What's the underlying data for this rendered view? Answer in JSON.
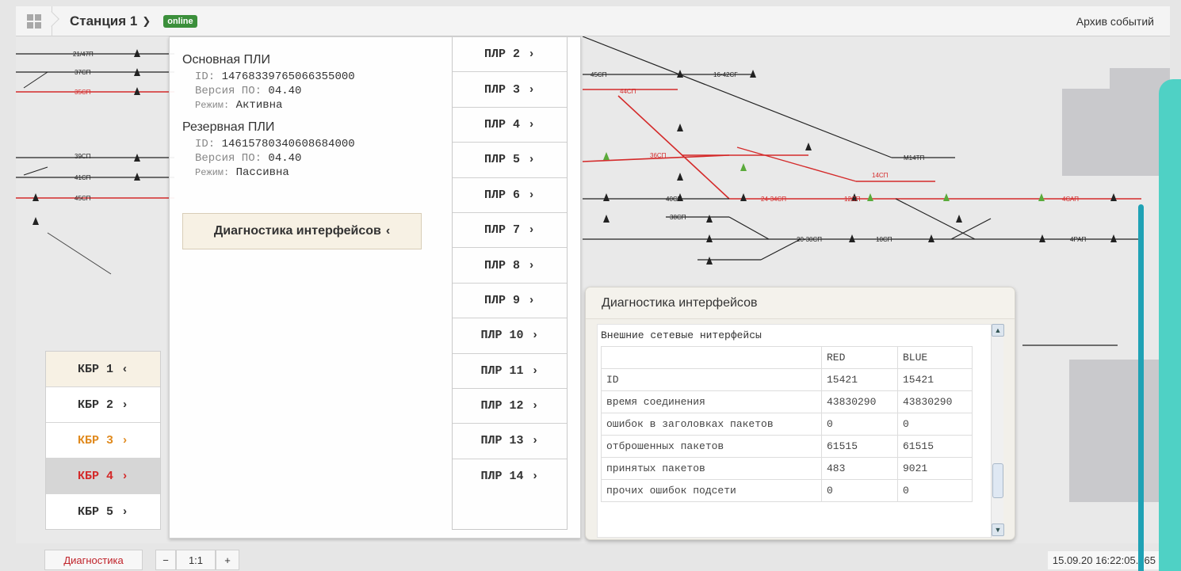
{
  "topbar": {
    "station_label": "Станция 1",
    "status_badge": "online",
    "archive_link": "Архив событий"
  },
  "primary_pli": {
    "title": "Основная ПЛИ",
    "id_label": "ID:",
    "id_value": "14768339765066355000",
    "version_label": "Версия ПО:",
    "version_value": "04.40",
    "mode_label": "Режим:",
    "mode_value": "Активна"
  },
  "reserve_pli": {
    "title": "Резервная ПЛИ",
    "id_label": "ID:",
    "id_value": "14615780340608684000",
    "version_label": "Версия ПО:",
    "version_value": "04.40",
    "mode_label": "Режим:",
    "mode_value": "Пассивна"
  },
  "diag_button": {
    "label": "Диагностика интерфейсов",
    "chevron": "‹"
  },
  "plr_items": [
    {
      "label": "ПЛР 2",
      "chevron": "›"
    },
    {
      "label": "ПЛР 3",
      "chevron": "›"
    },
    {
      "label": "ПЛР 4",
      "chevron": "›"
    },
    {
      "label": "ПЛР 5",
      "chevron": "›"
    },
    {
      "label": "ПЛР 6",
      "chevron": "›"
    },
    {
      "label": "ПЛР 7",
      "chevron": "›"
    },
    {
      "label": "ПЛР 8",
      "chevron": "›"
    },
    {
      "label": "ПЛР 9",
      "chevron": "›"
    },
    {
      "label": "ПЛР 10",
      "chevron": "›"
    },
    {
      "label": "ПЛР 11",
      "chevron": "›"
    },
    {
      "label": "ПЛР 12",
      "chevron": "›"
    },
    {
      "label": "ПЛР 13",
      "chevron": "›"
    },
    {
      "label": "ПЛР 14",
      "chevron": "›"
    }
  ],
  "kbr_items": [
    {
      "label": "КБР 1",
      "chevron": "‹",
      "color": "#333333"
    },
    {
      "label": "КБР 2",
      "chevron": "›",
      "color": "#333333"
    },
    {
      "label": "КБР 3",
      "chevron": "›",
      "color": "#e08a1e"
    },
    {
      "label": "КБР 4",
      "chevron": "›",
      "color": "#d42a2a"
    },
    {
      "label": "КБР 5",
      "chevron": "›",
      "color": "#333333"
    }
  ],
  "diag_window": {
    "title": "Диагностика интерфейсов",
    "subtitle": "Внешние сетевые нитерфейсы",
    "columns": [
      "",
      "RED",
      "BLUE"
    ],
    "rows": [
      [
        "ID",
        "15421",
        "15421"
      ],
      [
        "время соединения",
        "43830290",
        "43830290"
      ],
      [
        "ошибок в заголовках пакетов",
        "0",
        "0"
      ],
      [
        "отброшенных пакетов",
        "61515",
        "61515"
      ],
      [
        "принятых пакетов",
        "483",
        "9021"
      ],
      [
        "прочих ошибок подсети",
        "0",
        "0"
      ]
    ]
  },
  "bottombar": {
    "diag_button": "Диагностика",
    "zoom_out": "−",
    "zoom_ratio": "1:1",
    "zoom_in": "+",
    "timestamp": "15.09.20 16:22:05.365"
  },
  "schematic_labels": {
    "left": [
      "21/47П",
      "37СП",
      "35СП",
      "39СП",
      "41СП",
      "45СП"
    ],
    "right_top": [
      "45СП",
      "16-42СГ",
      "44СП",
      "М14ТП"
    ],
    "right_mid": [
      "36СП",
      "14СП",
      "40СП",
      "24-34СП",
      "12СП",
      "4САП"
    ],
    "right_low": [
      "38СП",
      "20-30СП",
      "10СП",
      "4РАП"
    ]
  },
  "colors": {
    "track_red": "#d42a2a",
    "track_black": "#222222",
    "accent_teal": "#4fd1c5",
    "accent_teal_dark": "#1fa2b5",
    "panel_active": "#f7f1e4"
  }
}
